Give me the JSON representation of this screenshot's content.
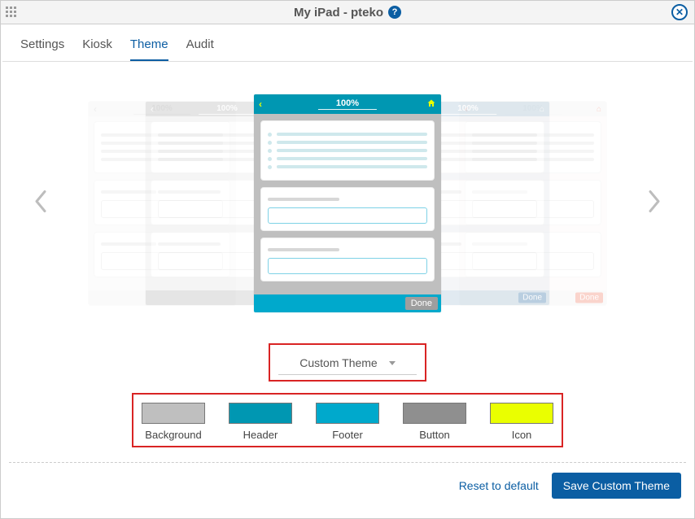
{
  "titlebar": {
    "title": "My iPad - pteko",
    "help_glyph": "?",
    "close_glyph": "✕"
  },
  "tabs": [
    {
      "label": "Settings",
      "active": false
    },
    {
      "label": "Kiosk",
      "active": false
    },
    {
      "label": "Theme",
      "active": true
    },
    {
      "label": "Audit",
      "active": false
    }
  ],
  "preview": {
    "progress_label": "100%",
    "done_label": "Done"
  },
  "theme_select": {
    "label": "Custom Theme"
  },
  "swatches": [
    {
      "label": "Background",
      "color": "#bfbfbf"
    },
    {
      "label": "Header",
      "color": "#0097b2"
    },
    {
      "label": "Footer",
      "color": "#00a9cc"
    },
    {
      "label": "Button",
      "color": "#8f8f8f"
    },
    {
      "label": "Icon",
      "color": "#eaff00"
    }
  ],
  "actions": {
    "reset": "Reset to default",
    "save": "Save Custom Theme"
  }
}
